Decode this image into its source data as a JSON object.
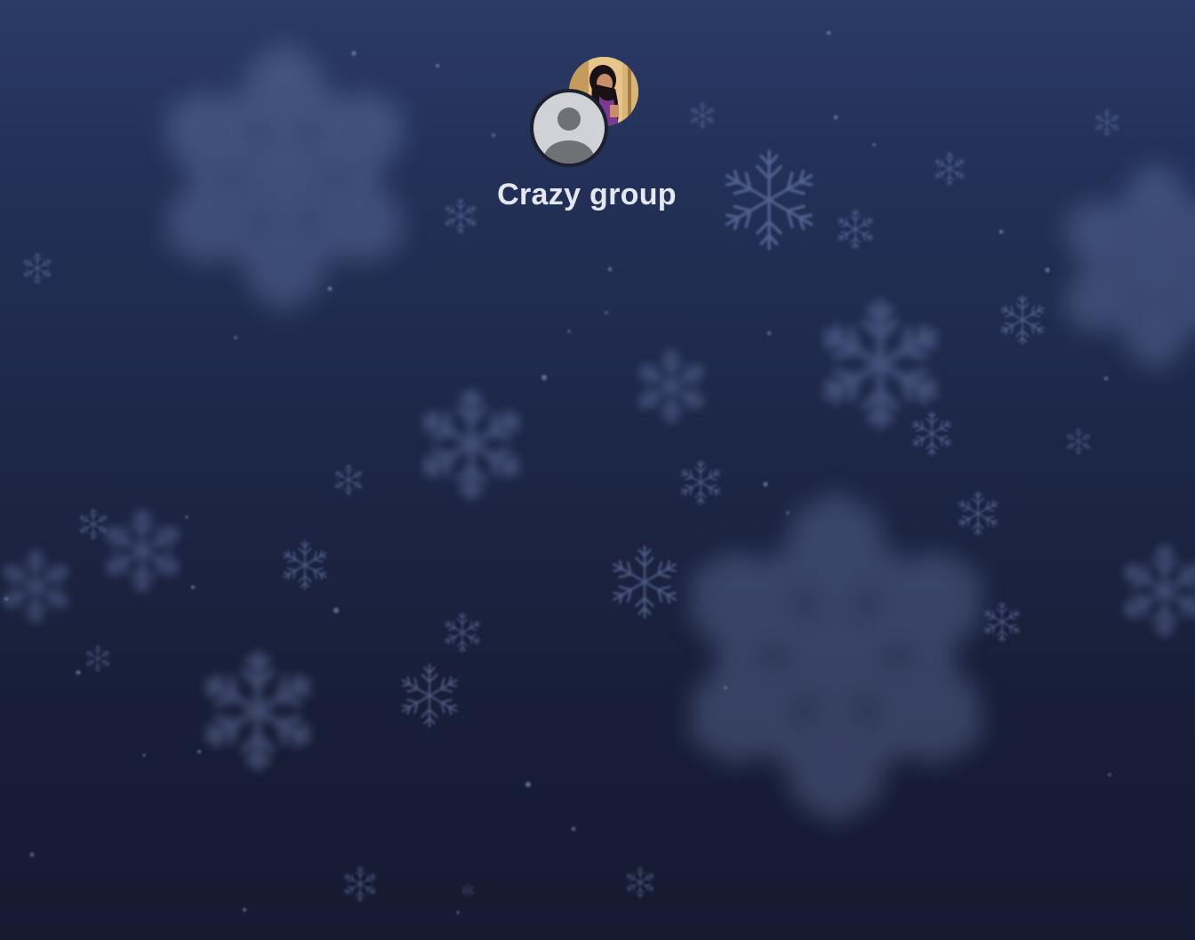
{
  "conversation": {
    "group_name": "Crazy group",
    "participants": [
      {
        "avatar": "photo-avatar-icon"
      },
      {
        "avatar": "default-person-icon"
      }
    ]
  },
  "background": {
    "theme": "snowflakes",
    "colors": {
      "top": "#2b3a66",
      "bottom": "#161a31",
      "flake": "#8a9fd4"
    }
  }
}
